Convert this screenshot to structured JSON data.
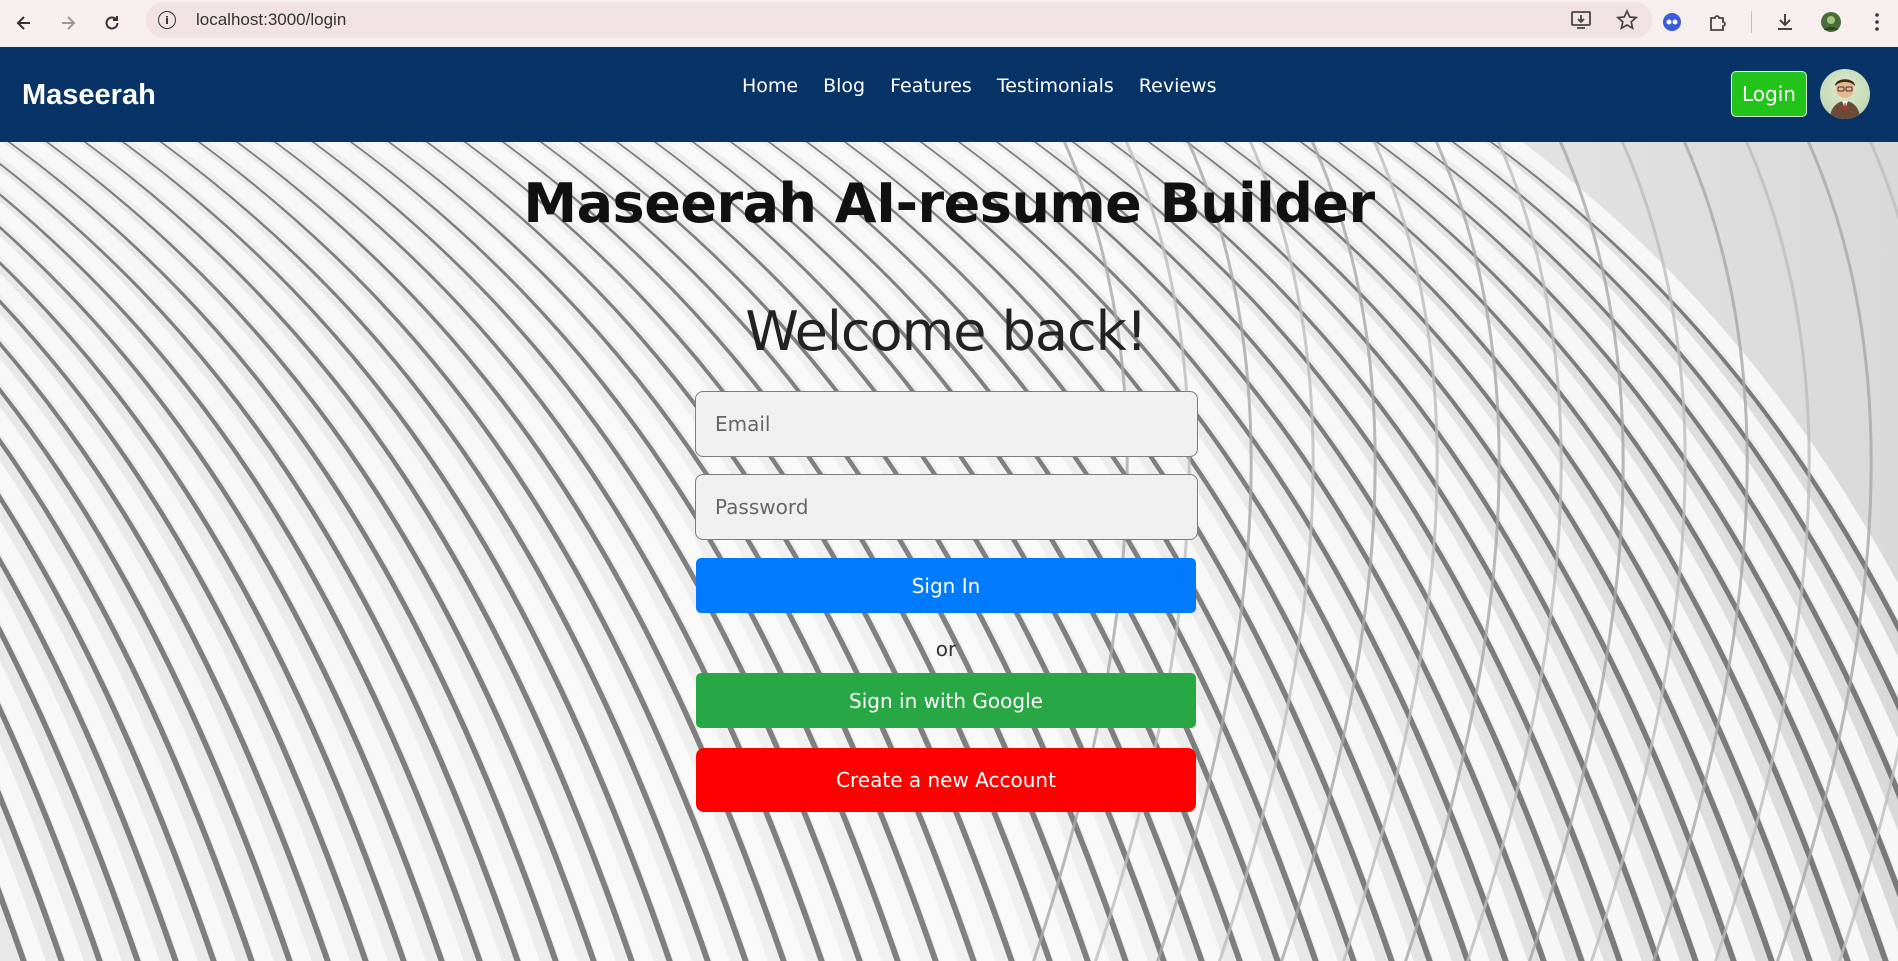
{
  "browser": {
    "url": "localhost:3000/login"
  },
  "navbar": {
    "brand": "Maseerah",
    "links": [
      "Home",
      "Blog",
      "Features",
      "Testimonials",
      "Reviews"
    ],
    "login_label": "Login"
  },
  "main": {
    "title": "Maseerah AI-resume Builder",
    "welcome": "Welcome back!",
    "email_placeholder": "Email",
    "password_placeholder": "Password",
    "sign_in_label": "Sign In",
    "or_text": "or",
    "google_label": "Sign in with Google",
    "create_label": "Create a new Account"
  },
  "colors": {
    "navbar": "#073366",
    "login_button": "#22c41a",
    "sign_in": "#007bff",
    "google": "#28a745",
    "create_account": "#ff0000"
  }
}
